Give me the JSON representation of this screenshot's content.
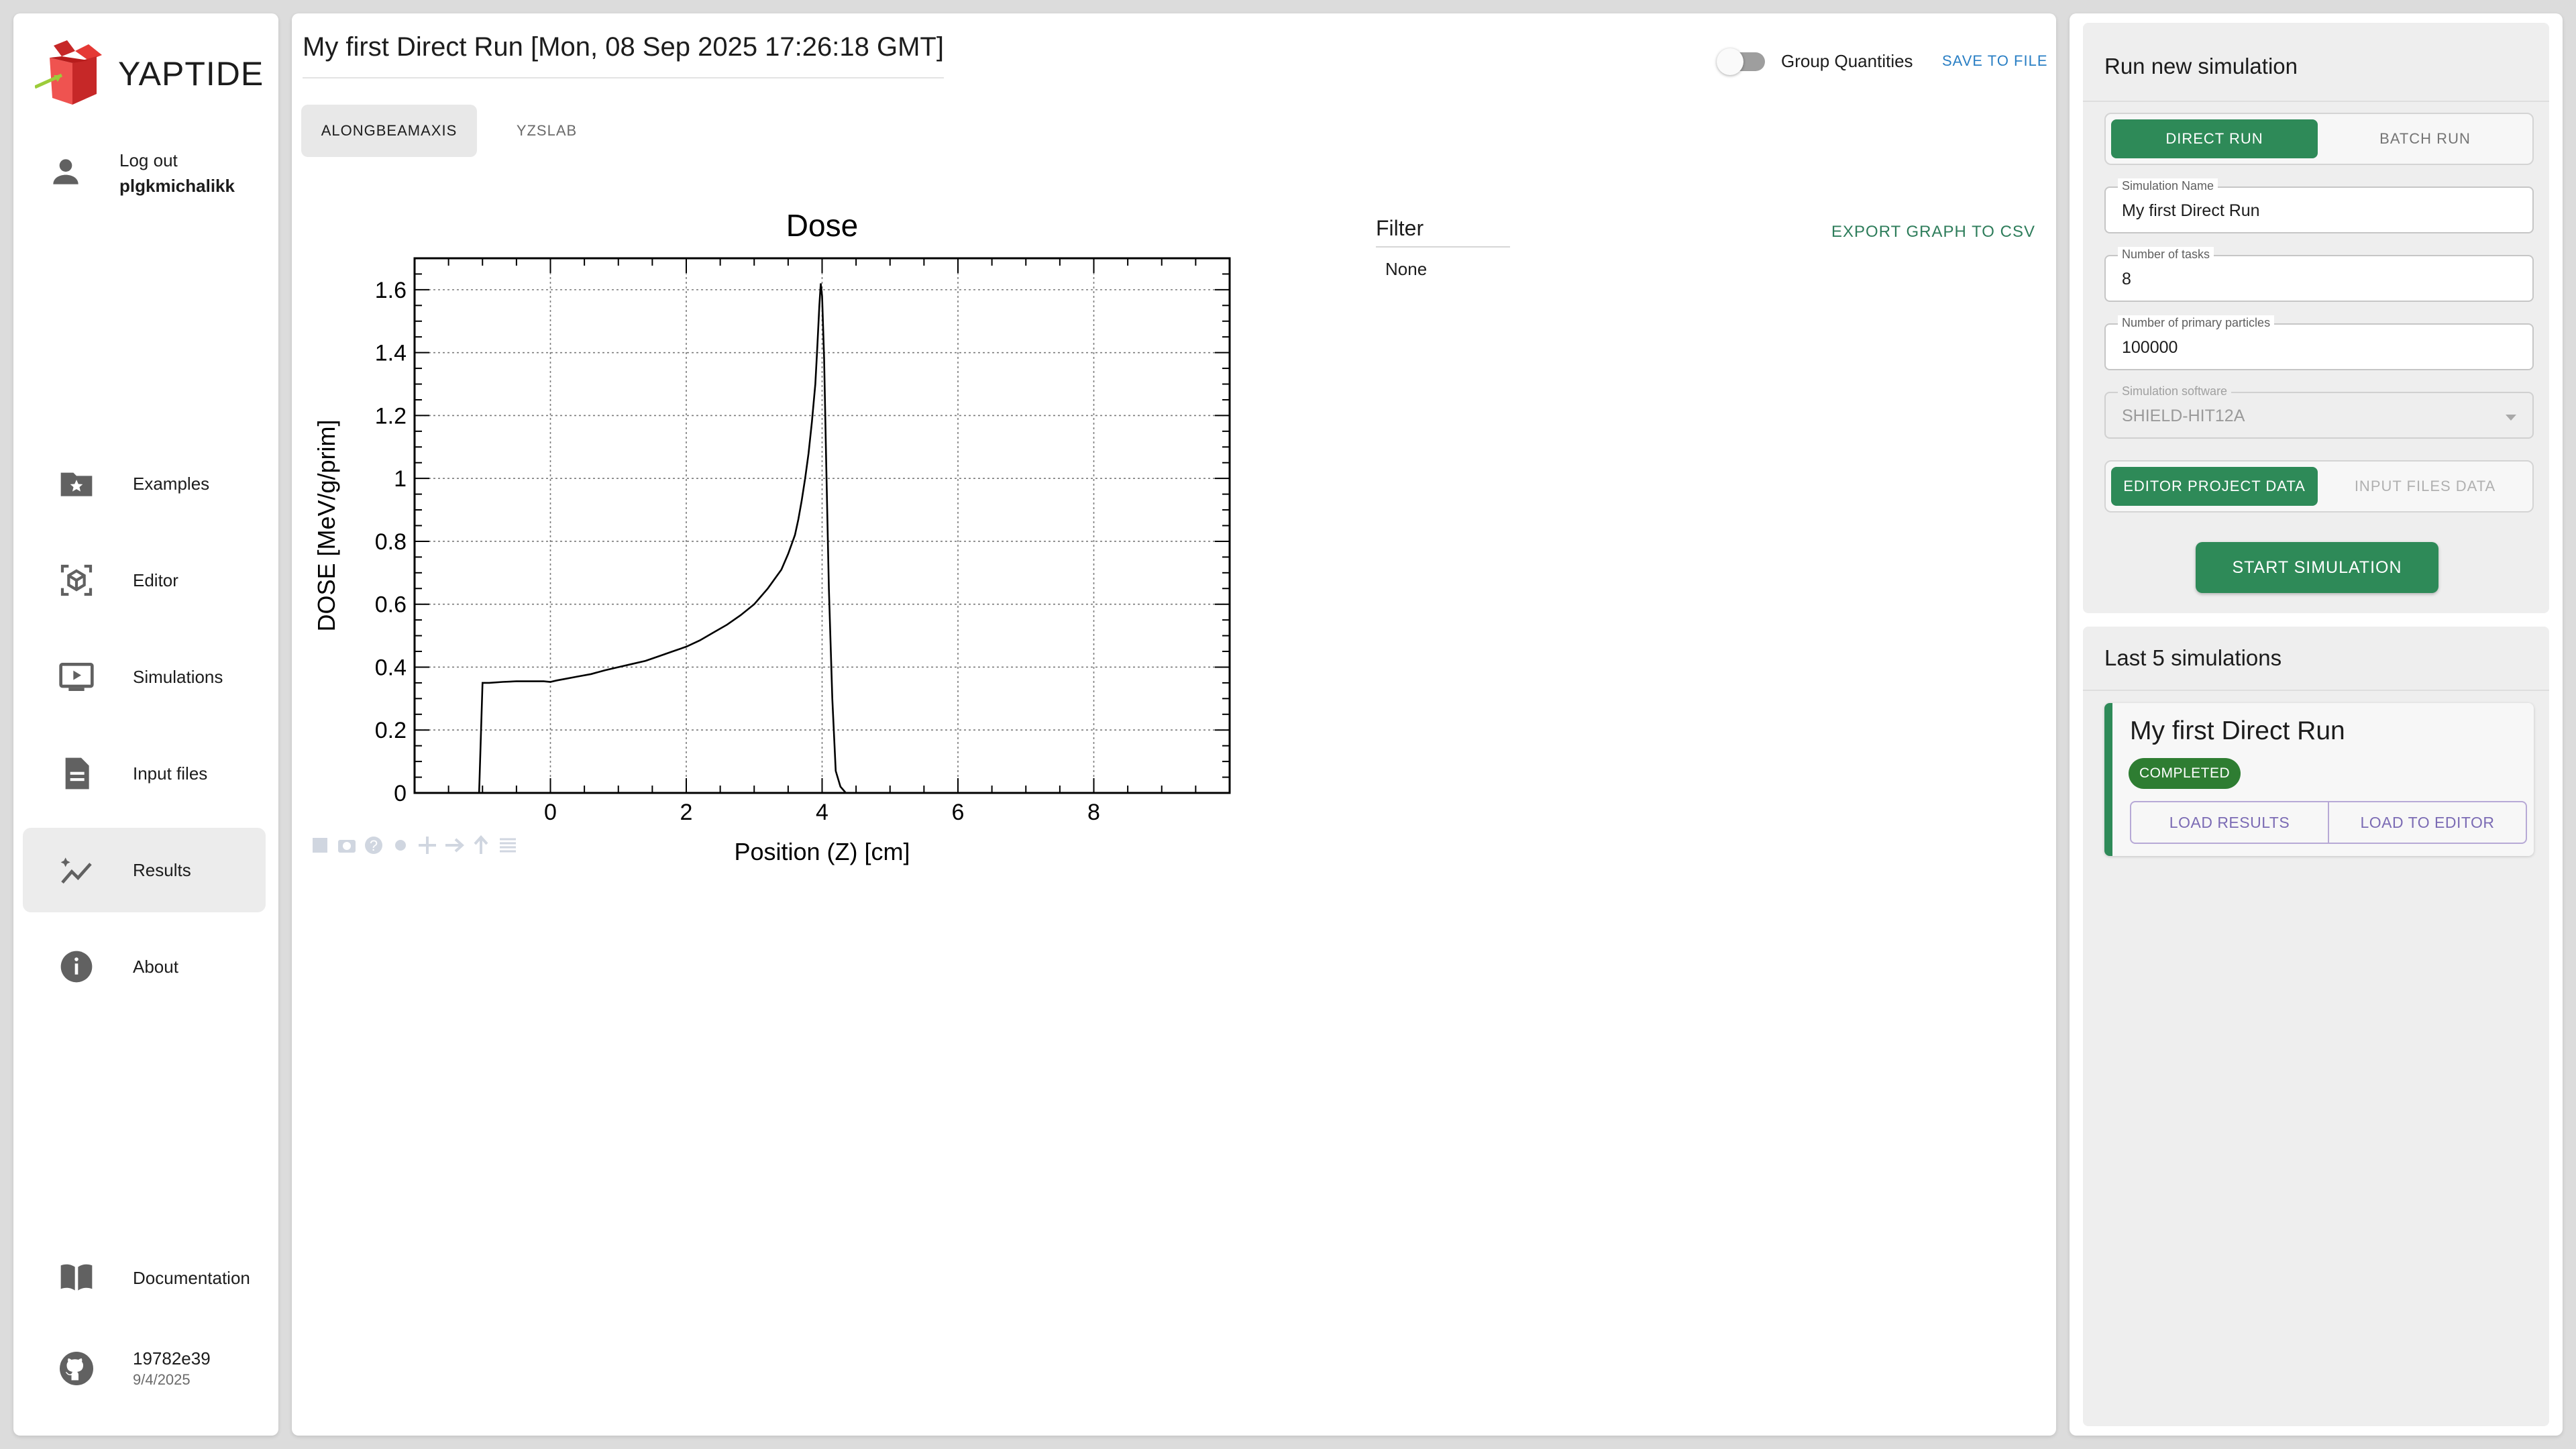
{
  "sidebar": {
    "app_name": "YAPTIDE",
    "user": {
      "action_label": "Log out",
      "username": "plgkmichalikk",
      "icon": "person-icon"
    },
    "items": [
      {
        "label": "Examples",
        "icon": "folder-star-icon",
        "active": false
      },
      {
        "label": "Editor",
        "icon": "cube-icon",
        "active": false
      },
      {
        "label": "Simulations",
        "icon": "monitor-play-icon",
        "active": false
      },
      {
        "label": "Input files",
        "icon": "document-icon",
        "active": false
      },
      {
        "label": "Results",
        "icon": "auto-graph-icon",
        "active": true
      },
      {
        "label": "About",
        "icon": "info-icon",
        "active": false
      }
    ],
    "documentation": {
      "label": "Documentation",
      "icon": "book-icon"
    },
    "version": {
      "hash": "19782e39",
      "date": "9/4/2025",
      "icon": "github-icon"
    }
  },
  "results": {
    "title": "My first Direct Run [Mon, 08 Sep 2025 17:26:18 GMT]",
    "group_quantities_label": "Group Quantities",
    "group_quantities_on": false,
    "save_label": "SAVE TO FILE",
    "tabs": [
      {
        "label": "ALONGBEAMAXIS",
        "active": true
      },
      {
        "label": "YZSLAB",
        "active": false
      }
    ],
    "filter": {
      "title": "Filter",
      "value": "None"
    },
    "export_label": "EXPORT GRAPH TO CSV",
    "plot_toolbar_icons": [
      "box-select-icon",
      "camera-icon",
      "help-icon",
      "dot-icon",
      "pan-icon",
      "arrow-right-icon",
      "arrow-up-icon",
      "lines-icon"
    ]
  },
  "chart_data": {
    "type": "line",
    "title": "Dose",
    "xlabel": "Position (Z) [cm]",
    "ylabel": "DOSE [MeV/g/prim]",
    "xlim": [
      -2,
      10
    ],
    "ylim": [
      0,
      1.7
    ],
    "xticks": [
      0,
      2,
      4,
      6,
      8
    ],
    "yticks": [
      0,
      0.2,
      0.4,
      0.6,
      0.8,
      1,
      1.2,
      1.4,
      1.6
    ],
    "grid": true,
    "line_color": "#000000",
    "series": [
      {
        "x": [
          -1.05,
          -1.0,
          -0.9,
          -0.7,
          -0.5,
          -0.3,
          -0.1,
          0.0,
          0.1,
          0.2,
          0.4,
          0.6,
          0.8,
          1.0,
          1.2,
          1.4,
          1.6,
          1.8,
          2.0,
          2.2,
          2.4,
          2.6,
          2.8,
          3.0,
          3.2,
          3.4,
          3.5,
          3.6,
          3.65,
          3.7,
          3.75,
          3.8,
          3.85,
          3.9,
          3.93,
          3.96,
          3.98,
          4.0,
          4.03,
          4.06,
          4.1,
          4.15,
          4.2,
          4.27,
          4.35,
          4.45
        ],
        "y": [
          0.0,
          0.35,
          0.35,
          0.353,
          0.355,
          0.355,
          0.355,
          0.353,
          0.358,
          0.362,
          0.37,
          0.378,
          0.39,
          0.4,
          0.41,
          0.42,
          0.435,
          0.45,
          0.465,
          0.485,
          0.51,
          0.535,
          0.565,
          0.6,
          0.65,
          0.71,
          0.76,
          0.82,
          0.87,
          0.93,
          1.0,
          1.08,
          1.18,
          1.3,
          1.42,
          1.55,
          1.62,
          1.58,
          1.38,
          1.05,
          0.65,
          0.3,
          0.07,
          0.02,
          0.0,
          0.0
        ]
      }
    ]
  },
  "run_panel": {
    "title": "Run new simulation",
    "run_modes": [
      {
        "label": "DIRECT RUN",
        "selected": true
      },
      {
        "label": "BATCH RUN",
        "selected": false
      }
    ],
    "fields": {
      "name": {
        "label": "Simulation Name",
        "value": "My first Direct Run"
      },
      "tasks": {
        "label": "Number of tasks",
        "value": "8"
      },
      "particles": {
        "label": "Number of primary particles",
        "value": "100000"
      },
      "software": {
        "label": "Simulation software",
        "value": "SHIELD-HIT12A",
        "disabled": true
      }
    },
    "data_sources": [
      {
        "label": "EDITOR PROJECT DATA",
        "selected": true
      },
      {
        "label": "INPUT FILES DATA",
        "selected": false
      }
    ],
    "start_label": "START SIMULATION"
  },
  "last_sims": {
    "title": "Last 5 simulations",
    "items": [
      {
        "name": "My first Direct Run",
        "status": "COMPLETED",
        "load_results_label": "LOAD RESULTS",
        "load_editor_label": "LOAD TO EDITOR"
      }
    ]
  },
  "colors": {
    "accent": "#2e8a58",
    "completed_badge": "#2e7d32",
    "link_blue": "#2a7fc4",
    "action_purple": "#7b6bb4"
  }
}
